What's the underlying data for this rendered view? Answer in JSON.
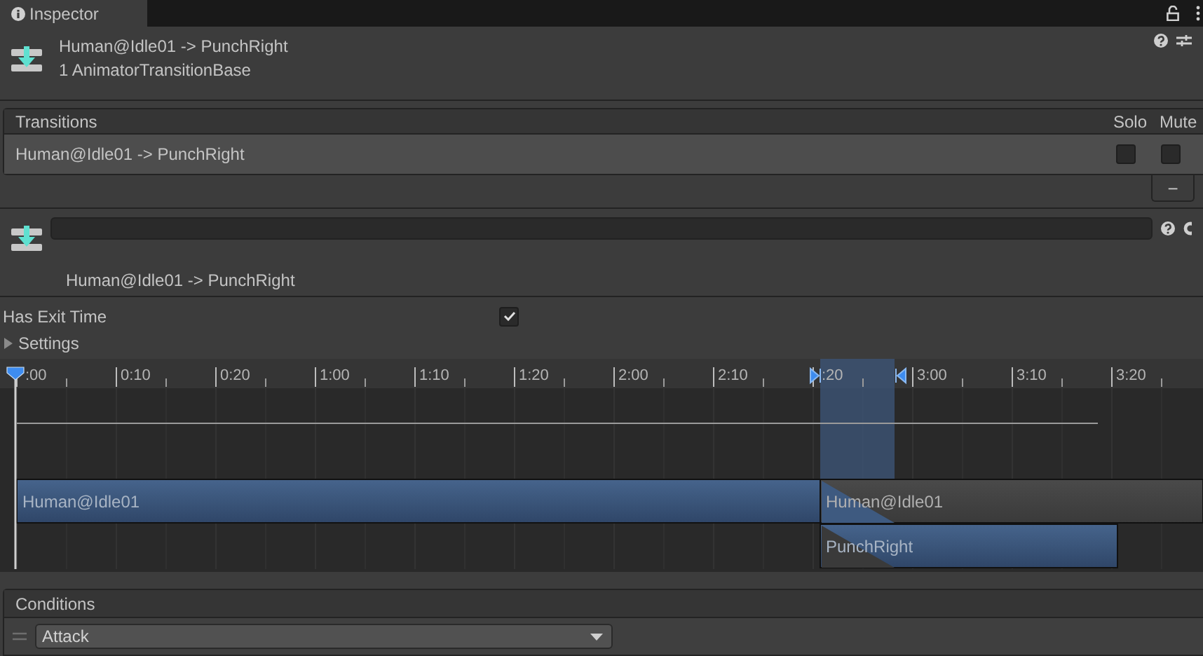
{
  "tab": {
    "title": "Inspector"
  },
  "header": {
    "title": "Human@Idle01 -> PunchRight",
    "subtitle": "1 AnimatorTransitionBase"
  },
  "transitions": {
    "title": "Transitions",
    "columns": [
      "Solo",
      "Mute"
    ],
    "rows": [
      {
        "name": "Human@Idle01 -> PunchRight",
        "solo": false,
        "mute": false
      }
    ],
    "remove_button": "−"
  },
  "transition": {
    "label": "Human@Idle01 -> PunchRight"
  },
  "has_exit_time": {
    "label": "Has Exit Time",
    "checked": true
  },
  "settings": {
    "label": "Settings",
    "expanded": false
  },
  "timeline": {
    "ruler_labels": [
      ":00",
      "0:10",
      "0:20",
      "1:00",
      "1:10",
      "1:20",
      "2:00",
      "2:10",
      ":20",
      "3:00",
      "3:10",
      "3:20"
    ],
    "clips": [
      {
        "label": "Human@Idle01",
        "kind": "source"
      },
      {
        "label": "Human@Idle01",
        "kind": "source-after"
      },
      {
        "label": "PunchRight",
        "kind": "destination"
      }
    ]
  },
  "conditions": {
    "title": "Conditions",
    "items": [
      {
        "parameter": "Attack"
      }
    ]
  }
}
